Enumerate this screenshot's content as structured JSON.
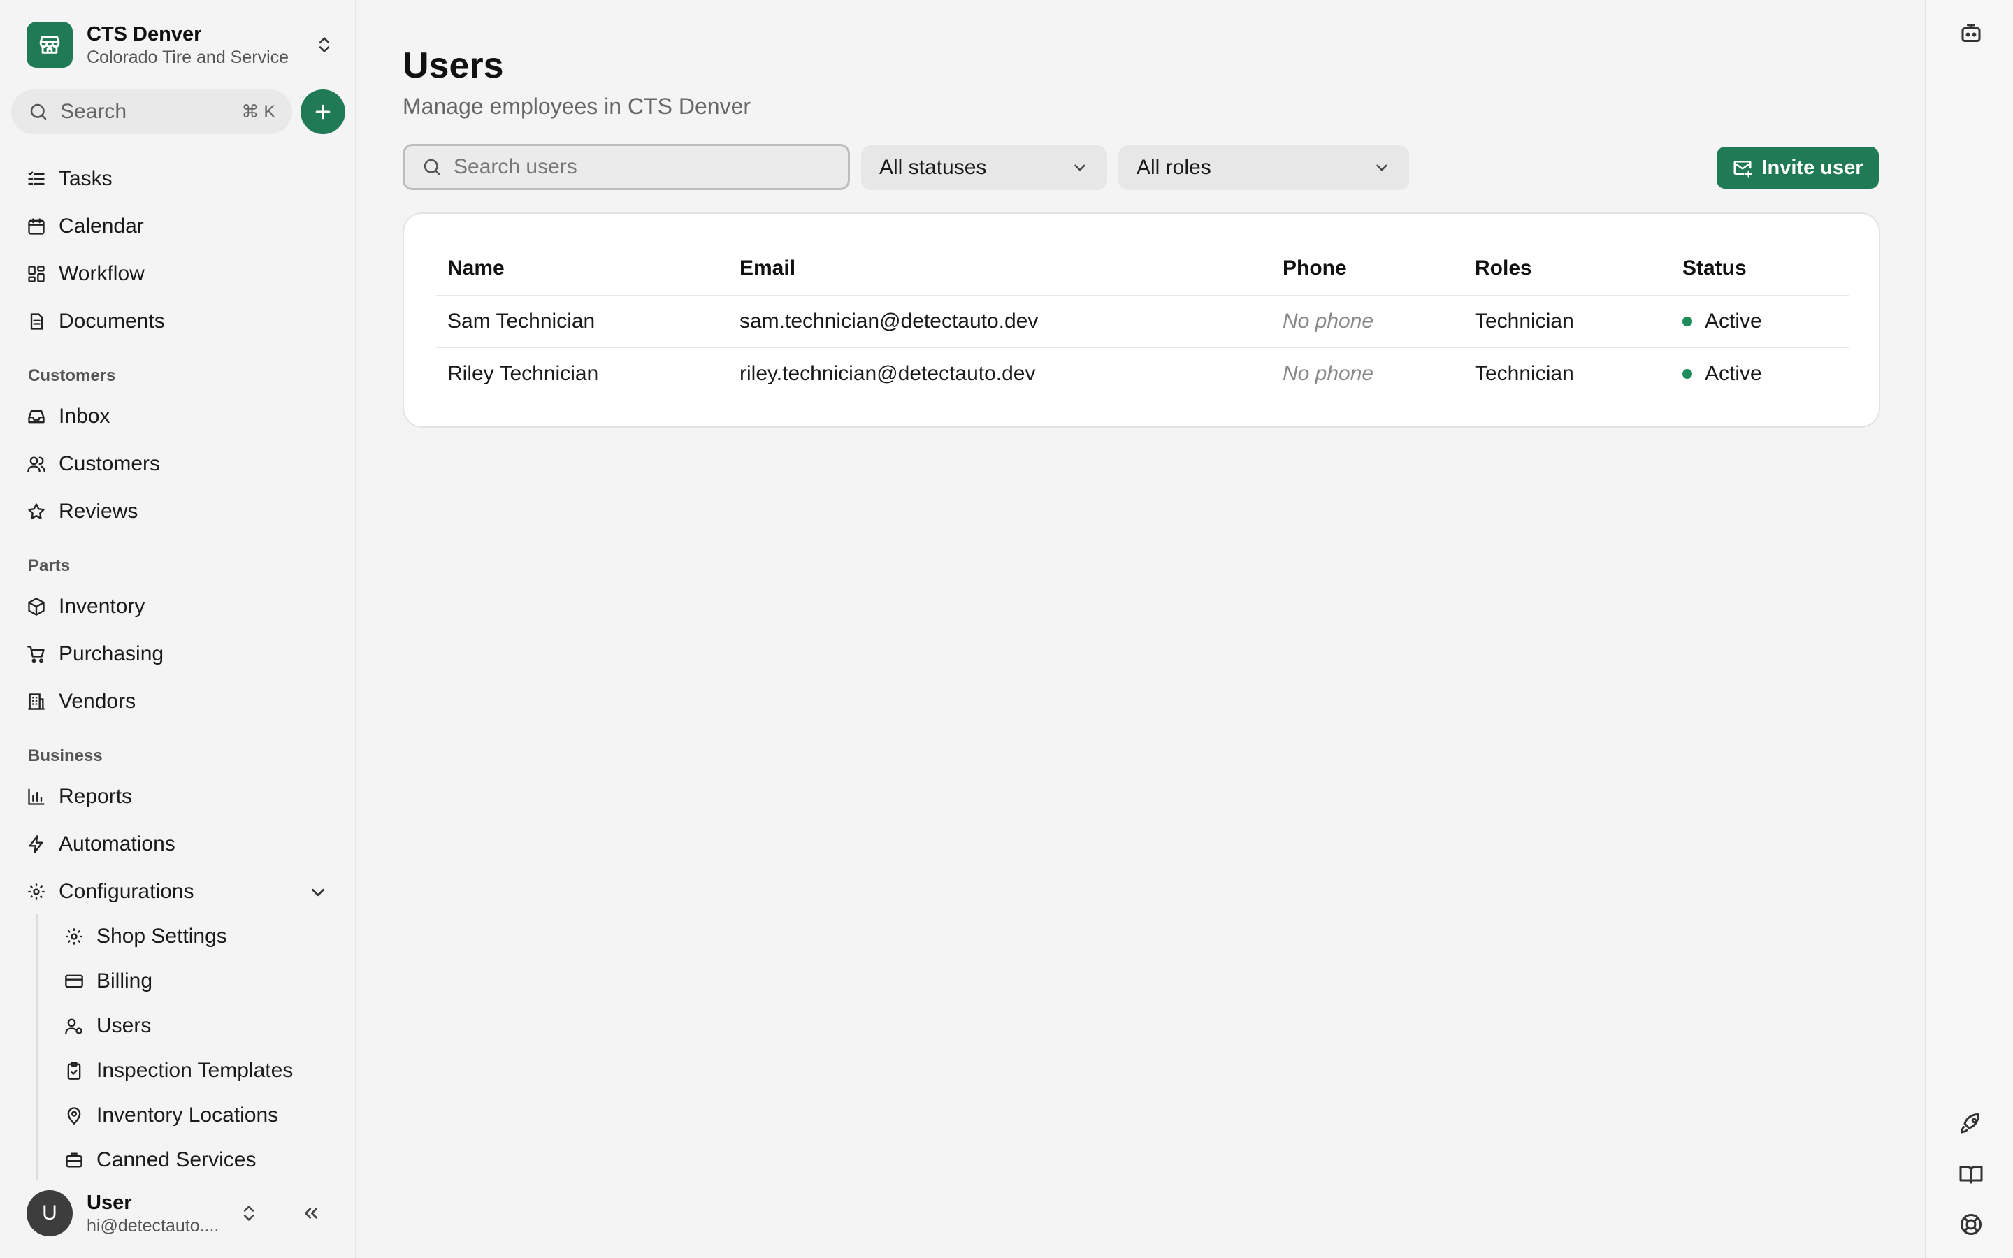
{
  "org": {
    "name": "CTS Denver",
    "subtitle": "Colorado Tire and Service"
  },
  "search": {
    "label": "Search",
    "shortcut": "⌘ K"
  },
  "nav": {
    "main": [
      {
        "label": "Tasks",
        "icon": "tasks-icon"
      },
      {
        "label": "Calendar",
        "icon": "calendar-icon"
      },
      {
        "label": "Workflow",
        "icon": "workflow-icon"
      },
      {
        "label": "Documents",
        "icon": "documents-icon"
      }
    ],
    "customers_heading": "Customers",
    "customers": [
      {
        "label": "Inbox",
        "icon": "inbox-icon"
      },
      {
        "label": "Customers",
        "icon": "customers-icon"
      },
      {
        "label": "Reviews",
        "icon": "star-icon"
      }
    ],
    "parts_heading": "Parts",
    "parts": [
      {
        "label": "Inventory",
        "icon": "box-icon"
      },
      {
        "label": "Purchasing",
        "icon": "cart-icon"
      },
      {
        "label": "Vendors",
        "icon": "building-icon"
      }
    ],
    "business_heading": "Business",
    "business": [
      {
        "label": "Reports",
        "icon": "chart-icon"
      },
      {
        "label": "Automations",
        "icon": "bolt-icon"
      },
      {
        "label": "Configurations",
        "icon": "gear-icon"
      }
    ],
    "configurations": [
      {
        "label": "Shop Settings",
        "icon": "gear-icon"
      },
      {
        "label": "Billing",
        "icon": "credit-card-icon"
      },
      {
        "label": "Users",
        "icon": "user-icon"
      },
      {
        "label": "Inspection Templates",
        "icon": "clipboard-icon"
      },
      {
        "label": "Inventory Locations",
        "icon": "map-pin-icon"
      },
      {
        "label": "Canned Services",
        "icon": "briefcase-icon"
      }
    ]
  },
  "user": {
    "initial": "U",
    "name": "User",
    "email": "hi@detectauto...."
  },
  "page": {
    "title": "Users",
    "subtitle": "Manage employees in CTS Denver"
  },
  "filters": {
    "search_placeholder": "Search users",
    "status": "All statuses",
    "roles": "All roles",
    "invite_label": "Invite user"
  },
  "table": {
    "headers": {
      "name": "Name",
      "email": "Email",
      "phone": "Phone",
      "roles": "Roles",
      "status": "Status"
    },
    "rows": [
      {
        "name": "Sam Technician",
        "email": "sam.technician@detectauto.dev",
        "phone": "No phone",
        "roles": "Technician",
        "status": "Active"
      },
      {
        "name": "Riley Technician",
        "email": "riley.technician@detectauto.dev",
        "phone": "No phone",
        "roles": "Technician",
        "status": "Active"
      }
    ]
  },
  "colors": {
    "accent": "#1f7a55",
    "status_active": "#1f8a5a"
  }
}
